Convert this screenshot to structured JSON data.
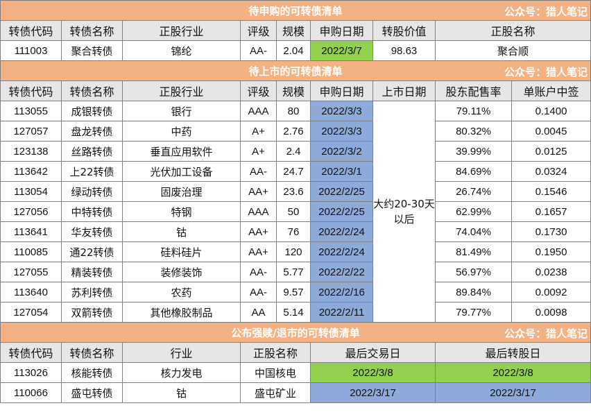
{
  "section1": {
    "title": "待申购的可转债清单",
    "publisher": "公众号：猎人笔记",
    "headers": [
      "转债代码",
      "转债名称",
      "正股行业",
      "评级",
      "规模",
      "申购日期",
      "转股价值",
      "正股名称"
    ],
    "rows": [
      [
        "111003",
        "聚合转债",
        "锦纶",
        "AA-",
        "2.04",
        "2022/3/7",
        "98.63",
        "聚合顺"
      ]
    ]
  },
  "section2": {
    "title": "待上市的可转债清单",
    "publisher": "公众号：猎人笔记",
    "headers": [
      "转债代码",
      "转债名称",
      "正股行业",
      "评级",
      "规模",
      "申购日期",
      "上市日期",
      "股东配售率",
      "单账户中签"
    ],
    "listing_note": "大约20-30天以后",
    "rows": [
      [
        "113055",
        "成银转债",
        "银行",
        "AAA",
        "80",
        "2022/3/3",
        "79.11%",
        "0.1400"
      ],
      [
        "127057",
        "盘龙转债",
        "中药",
        "A+",
        "2.76",
        "2022/3/3",
        "80.32%",
        "0.0045"
      ],
      [
        "123138",
        "丝路转债",
        "垂直应用软件",
        "A+",
        "2.4",
        "2022/3/2",
        "39.99%",
        "0.0125"
      ],
      [
        "113642",
        "上22转债",
        "光伏加工设备",
        "AA-",
        "24.7",
        "2022/3/1",
        "84.69%",
        "0.0324"
      ],
      [
        "113054",
        "绿动转债",
        "固废治理",
        "AA+",
        "23.6",
        "2022/2/25",
        "26.74%",
        "0.1546"
      ],
      [
        "127056",
        "中特转债",
        "特钢",
        "AAA",
        "50",
        "2022/2/25",
        "62.99%",
        "0.1657"
      ],
      [
        "113641",
        "华友转债",
        "钴",
        "AA+",
        "76",
        "2022/2/24",
        "74.04%",
        "0.1730"
      ],
      [
        "110085",
        "通22转债",
        "硅料硅片",
        "AA+",
        "120",
        "2022/2/24",
        "81.49%",
        "0.1950"
      ],
      [
        "127055",
        "精装转债",
        "装修装饰",
        "AA-",
        "5.77",
        "2022/2/22",
        "56.97%",
        "0.0238"
      ],
      [
        "113640",
        "苏利转债",
        "农药",
        "AA-",
        "9.57",
        "2022/2/16",
        "89.84%",
        "0.0092"
      ],
      [
        "127054",
        "双箭转债",
        "其他橡胶制品",
        "AA",
        "5.14",
        "2022/2/11",
        "79.77%",
        "0.0098"
      ]
    ]
  },
  "section3": {
    "title": "公布强赎/退市的可转债清单",
    "publisher": "公众号：猎人笔记",
    "headers": [
      "转债代码",
      "转债名称",
      "行业",
      "正股名称",
      "最后交易日",
      "最后转股日"
    ],
    "rows": [
      [
        "113026",
        "核能转债",
        "核力发电",
        "中国核电",
        "2022/3/8",
        "2022/3/8"
      ],
      [
        "110066",
        "盛屯转债",
        "钴",
        "盛屯矿业",
        "2022/3/17",
        "2022/3/17"
      ]
    ]
  },
  "colors": {
    "banner": "#f4b183",
    "header": "#e7e6e6",
    "green": "#92d050",
    "blue": "#8eaadb"
  }
}
